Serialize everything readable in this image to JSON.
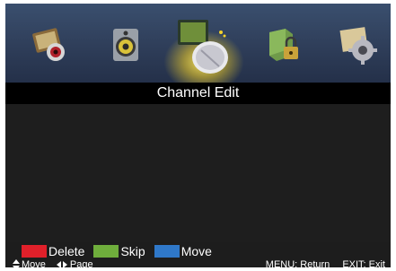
{
  "menu": {
    "icons": [
      {
        "name": "picture-icon",
        "active": false
      },
      {
        "name": "sound-icon",
        "active": false
      },
      {
        "name": "channel-icon",
        "active": true
      },
      {
        "name": "lock-icon",
        "active": false
      },
      {
        "name": "setup-icon",
        "active": false
      }
    ],
    "highlight_color": "#f5d22a"
  },
  "title": "Channel Edit",
  "channel_list": [],
  "legend": {
    "delete": {
      "label": "Delete",
      "color": "#e0202a"
    },
    "skip": {
      "label": "Skip",
      "color": "#6fae3c"
    },
    "move": {
      "label": "Move",
      "color": "#2f78c9"
    }
  },
  "help": {
    "move_label": "Move",
    "page_label": "Page",
    "menu_hint": "MENU: Return",
    "exit_hint": "EXIT: Exit"
  }
}
